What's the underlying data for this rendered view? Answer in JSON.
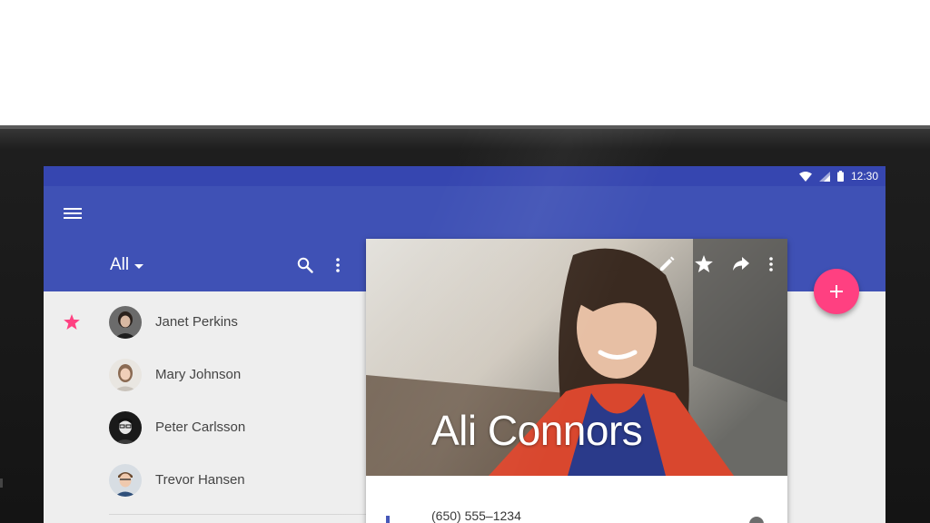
{
  "status_bar": {
    "time": "12:30"
  },
  "app_bar": {
    "filter_label": "All"
  },
  "contacts": [
    {
      "name": "Janet Perkins",
      "favorite": true
    },
    {
      "name": "Mary Johnson",
      "favorite": false
    },
    {
      "name": "Peter Carlsson",
      "favorite": false
    },
    {
      "name": "Trevor Hansen",
      "favorite": false
    }
  ],
  "detail_card": {
    "name": "Ali Connors",
    "phone": "(650) 555–1234"
  },
  "colors": {
    "primary": "#3f51b5",
    "primary_dark": "#3646b0",
    "accent": "#ff4081",
    "favorite_star": "#ff4081"
  },
  "icons": [
    "menu-icon",
    "dropdown-caret-icon",
    "search-icon",
    "more-vert-icon",
    "star-icon",
    "edit-icon",
    "share-icon",
    "add-icon",
    "wifi-icon",
    "signal-icon",
    "battery-icon"
  ]
}
